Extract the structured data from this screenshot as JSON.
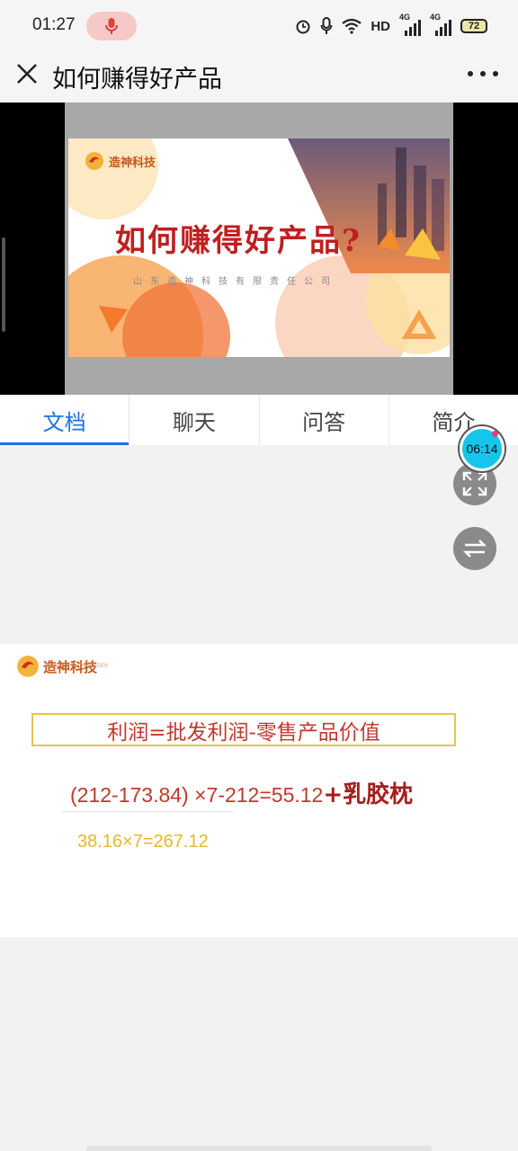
{
  "status_bar": {
    "time": "01:27",
    "hd_label": "HD",
    "signal1_label": "4G",
    "signal2_label": "4G",
    "battery": "72"
  },
  "header": {
    "title": "如何赚得好产品"
  },
  "video": {
    "slide_logo": "造神科技",
    "slide_title": "如何赚得好产品?",
    "slide_subtitle": "山东造神科技有限责任公司"
  },
  "tabs": [
    {
      "label": "文档",
      "active": true
    },
    {
      "label": "聊天",
      "active": false
    },
    {
      "label": "问答",
      "active": false
    },
    {
      "label": "简介",
      "active": false
    }
  ],
  "timer": "06:14",
  "doc_slide": {
    "logo": "造神科技",
    "logo_sub": "ZAOSHEN TECHNOLOGY",
    "formula": "利润=批发利润-零售产品价值",
    "calc_text": "(212-173.84) ×7-212=55.12",
    "calc_emph": "+乳胶枕",
    "yellow_text": "38.16×7=267.12"
  },
  "colors": {
    "accent_blue": "#1a73e8",
    "formula_red": "#c0392b",
    "yellow": "#e8b82a",
    "timer_cyan": "#16c6ea"
  }
}
